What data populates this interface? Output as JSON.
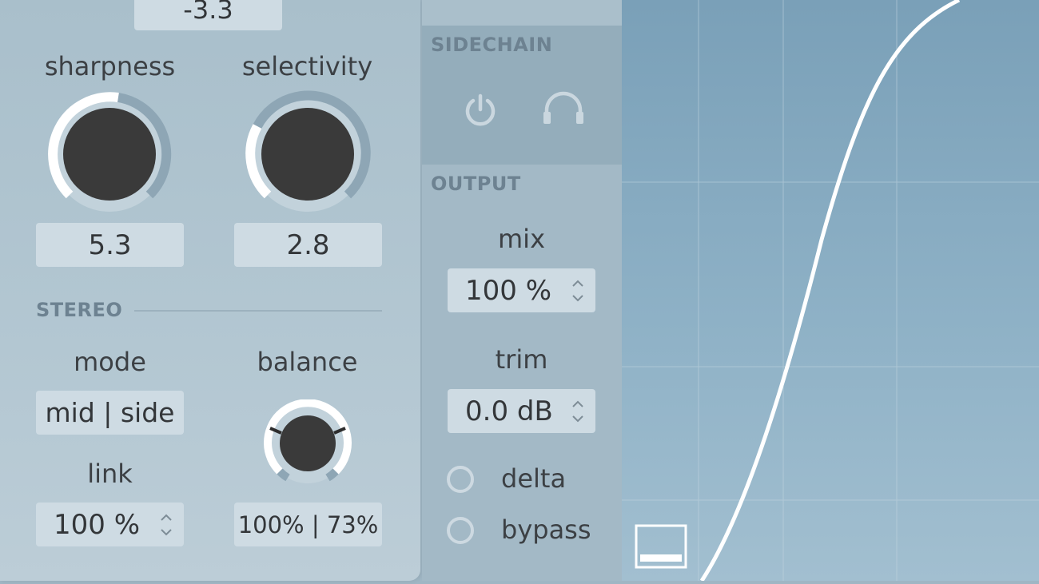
{
  "top_value": "-3.3",
  "dynamics": {
    "sharpness": {
      "label": "sharpness",
      "value": "5.3"
    },
    "selectivity": {
      "label": "selectivity",
      "value": "2.8"
    }
  },
  "stereo": {
    "title": "STEREO",
    "mode": {
      "label": "mode",
      "value": "mid | side"
    },
    "balance": {
      "label": "balance",
      "value": "100% | 73%"
    },
    "link": {
      "label": "link",
      "value": "100 %"
    }
  },
  "sidechain": {
    "title": "SIDECHAIN"
  },
  "output": {
    "title": "OUTPUT",
    "mix": {
      "label": "mix",
      "value": "100 %"
    },
    "trim": {
      "label": "trim",
      "value": "0.0 dB"
    },
    "delta": {
      "label": "delta"
    },
    "bypass": {
      "label": "bypass"
    }
  },
  "icons": [
    "power-icon",
    "headphones-icon",
    "panel-toggle-icon",
    "stepper-arrows-icon"
  ],
  "colors": {
    "knob": "#3a3a3a",
    "arc": "#ffffff",
    "curve": "#ffffff",
    "plot_bg": "#7aa0b8"
  }
}
